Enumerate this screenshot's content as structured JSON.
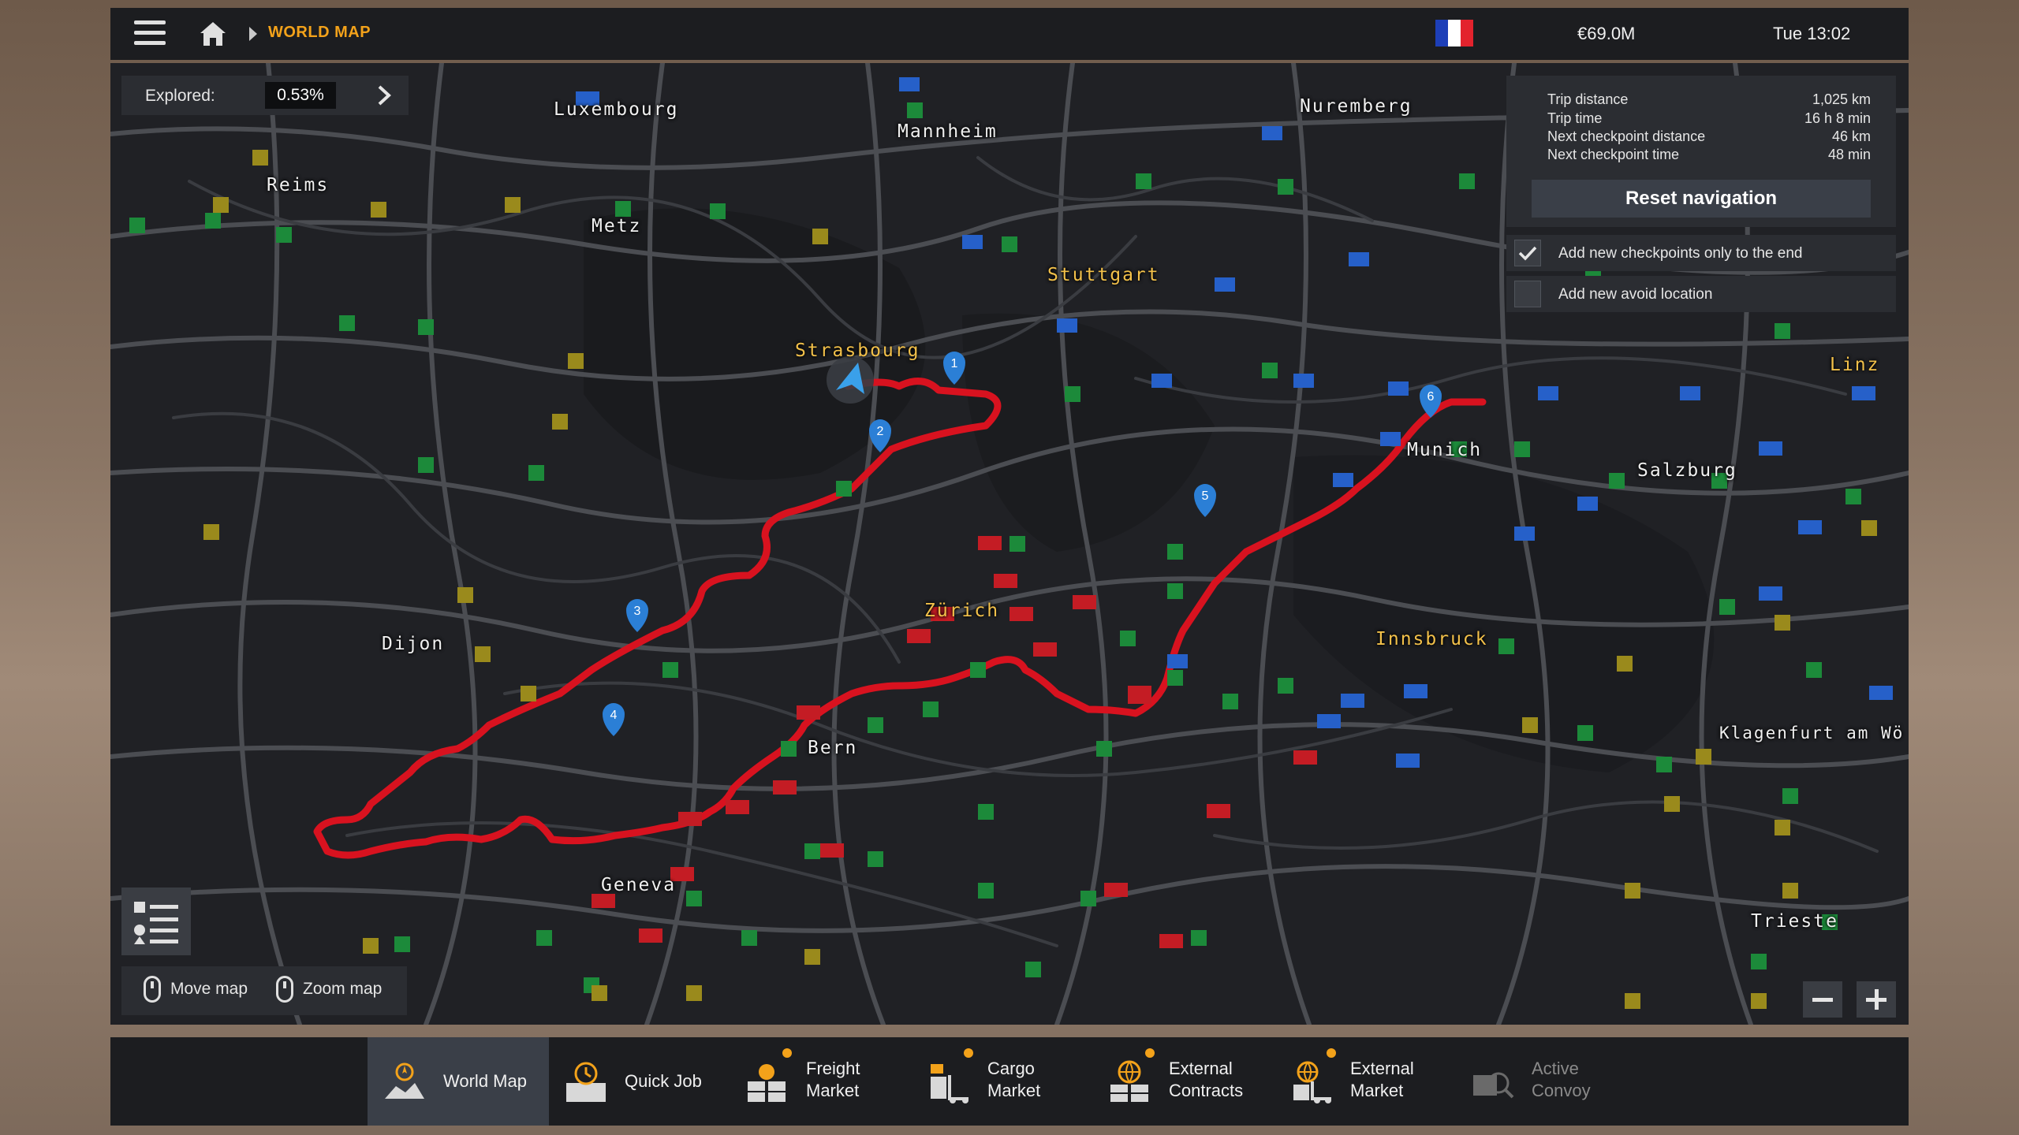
{
  "topbar": {
    "breadcrumb": "WORLD MAP",
    "money": "€69.0M",
    "clock": "Tue 13:02",
    "flag_colors": [
      "#1d3fb8",
      "#ffffff",
      "#e3232d"
    ]
  },
  "explored": {
    "label": "Explored:",
    "value": "0.53%"
  },
  "trip": {
    "rows": [
      {
        "key": "Trip distance",
        "value": "1,025 km"
      },
      {
        "key": "Trip time",
        "value": "16 h 8 min"
      },
      {
        "key": "Next checkpoint distance",
        "value": "46 km"
      },
      {
        "key": "Next checkpoint time",
        "value": "48 min"
      }
    ],
    "reset_label": "Reset navigation"
  },
  "options": [
    {
      "label": "Add new checkpoints only to the end",
      "checked": true
    },
    {
      "label": "Add new avoid location",
      "checked": false
    }
  ],
  "controls": {
    "move": "Move map",
    "zoom": "Zoom map"
  },
  "cities": [
    {
      "name": "Luxembourg"
    },
    {
      "name": "Mannheim"
    },
    {
      "name": "Nuremberg"
    },
    {
      "name": "Reims"
    },
    {
      "name": "Metz"
    },
    {
      "name": "Stuttgart"
    },
    {
      "name": "Strasbourg"
    },
    {
      "name": "Munich"
    },
    {
      "name": "Salzburg"
    },
    {
      "name": "Linz"
    },
    {
      "name": "Zürich"
    },
    {
      "name": "Dijon"
    },
    {
      "name": "Innsbruck"
    },
    {
      "name": "Bern"
    },
    {
      "name": "Klagenfurt am Wö"
    },
    {
      "name": "Geneva"
    },
    {
      "name": "Trieste"
    }
  ],
  "route_color": "#d8121f",
  "checkpoints": [
    "1",
    "2",
    "3",
    "4",
    "5",
    "6"
  ],
  "tabs": [
    {
      "line1": "World Map",
      "line2": "",
      "active": true,
      "dot": false,
      "disabled": false
    },
    {
      "line1": "Quick Job",
      "line2": "",
      "active": false,
      "dot": false,
      "disabled": false
    },
    {
      "line1": "Freight",
      "line2": "Market",
      "active": false,
      "dot": true,
      "disabled": false
    },
    {
      "line1": "Cargo",
      "line2": "Market",
      "active": false,
      "dot": true,
      "disabled": false
    },
    {
      "line1": "External",
      "line2": "Contracts",
      "active": false,
      "dot": true,
      "disabled": false
    },
    {
      "line1": "External",
      "line2": "Market",
      "active": false,
      "dot": true,
      "disabled": false
    },
    {
      "line1": "Active",
      "line2": "Convoy",
      "active": false,
      "dot": false,
      "disabled": true
    }
  ]
}
